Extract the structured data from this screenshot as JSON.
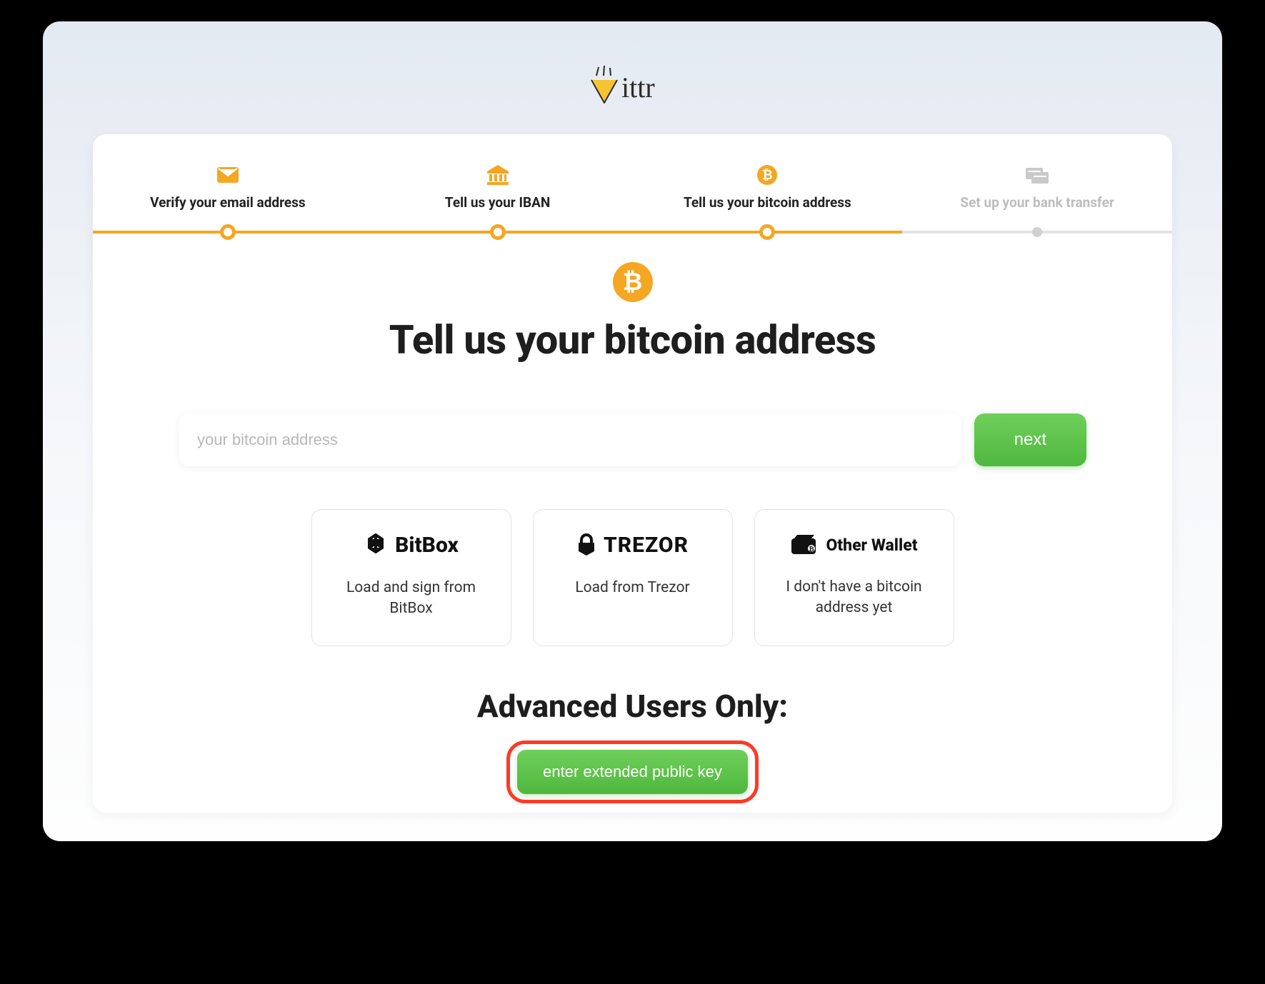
{
  "brand": "ittr",
  "stepper": {
    "steps": [
      {
        "label": "Verify your email address",
        "active": true
      },
      {
        "label": "Tell us your IBAN",
        "active": true
      },
      {
        "label": "Tell us your bitcoin address",
        "active": true
      },
      {
        "label": "Set up your bank transfer",
        "active": false
      }
    ]
  },
  "page": {
    "title": "Tell us your bitcoin address"
  },
  "input": {
    "placeholder": "your bitcoin address",
    "next_label": "next"
  },
  "wallets": {
    "bitbox": {
      "brand": "BitBox",
      "desc": "Load and sign from BitBox"
    },
    "trezor": {
      "brand": "TREZOR",
      "desc": "Load from Trezor"
    },
    "other": {
      "brand": "Other Wallet",
      "desc": "I don't have a bitcoin address yet"
    }
  },
  "advanced": {
    "title": "Advanced Users Only:",
    "button_label": "enter extended public key"
  }
}
